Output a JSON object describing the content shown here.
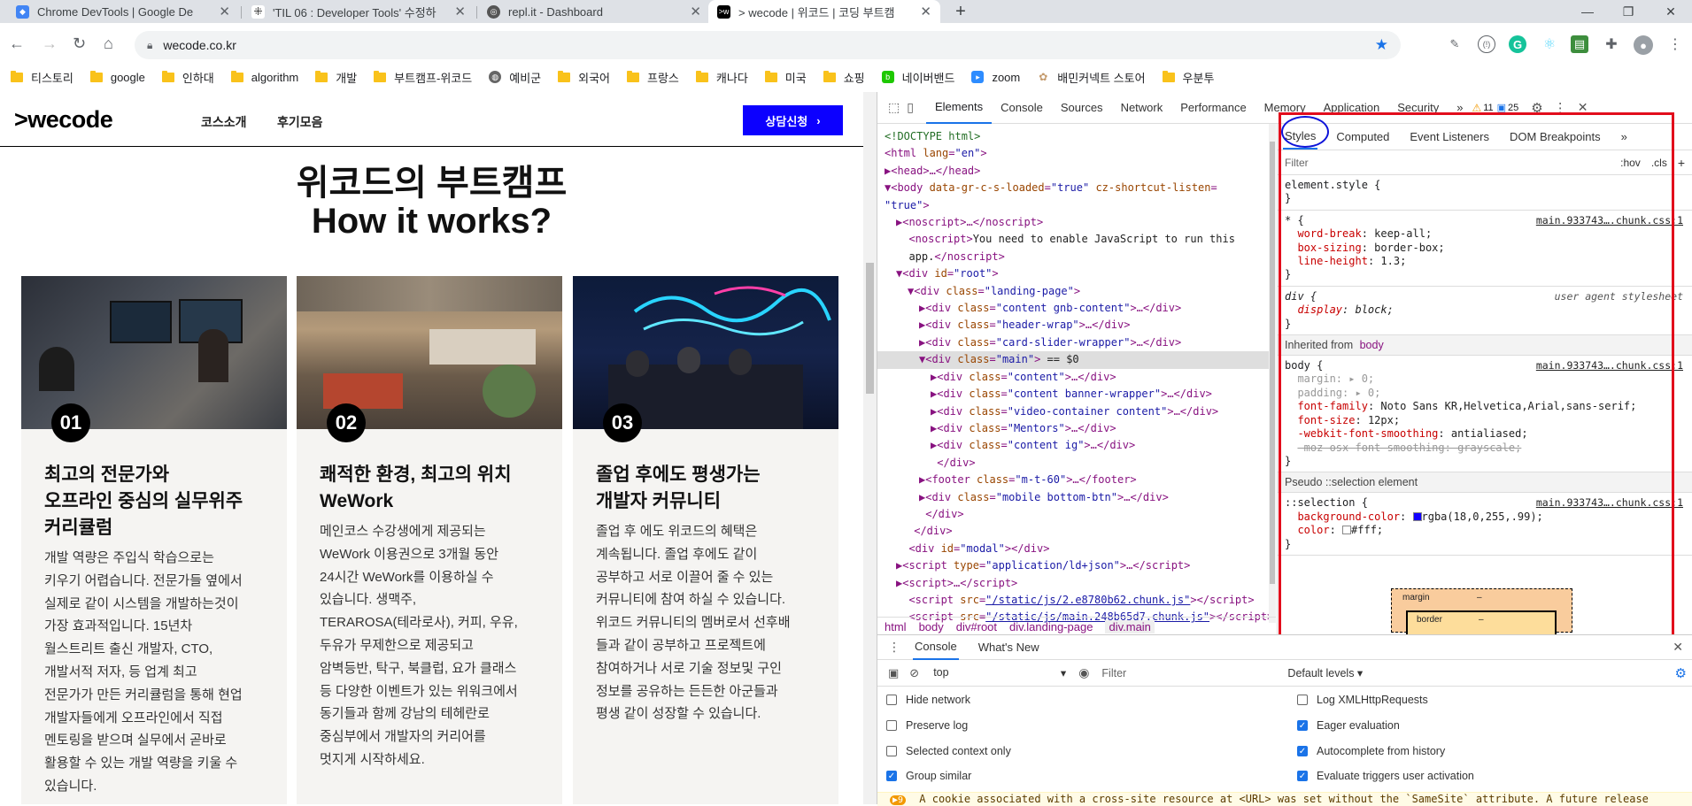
{
  "tabs": [
    {
      "title": "Chrome DevTools | Google De",
      "favicon_color": "#4285f4",
      "active": false
    },
    {
      "title": "'TIL 06 : Developer Tools' 수정하",
      "favicon_color": "#333333",
      "active": false
    },
    {
      "title": "repl.it - Dashboard",
      "favicon_color": "#555555",
      "active": false
    },
    {
      "title": "> wecode | 위코드 | 코딩 부트캠",
      "favicon_color": "#000000",
      "active": true
    }
  ],
  "new_tab_label": "+",
  "address": {
    "url": "wecode.co.kr"
  },
  "bookmarks": [
    {
      "label": "티스토리",
      "kind": "folder"
    },
    {
      "label": "google",
      "kind": "folder"
    },
    {
      "label": "인하대",
      "kind": "folder"
    },
    {
      "label": "algorithm",
      "kind": "folder"
    },
    {
      "label": "개발",
      "kind": "folder"
    },
    {
      "label": "부트캠프-위코드",
      "kind": "folder"
    },
    {
      "label": "예비군",
      "kind": "globe"
    },
    {
      "label": "외국어",
      "kind": "folder"
    },
    {
      "label": "프랑스",
      "kind": "folder"
    },
    {
      "label": "캐나다",
      "kind": "folder"
    },
    {
      "label": "미국",
      "kind": "folder"
    },
    {
      "label": "쇼핑",
      "kind": "folder"
    },
    {
      "label": "네이버밴드",
      "kind": "band"
    },
    {
      "label": "zoom",
      "kind": "zoom"
    },
    {
      "label": "배민커넥트 스토어",
      "kind": "baemin"
    },
    {
      "label": "우분투",
      "kind": "folder"
    }
  ],
  "site": {
    "logo": ">wecode",
    "nav": [
      "코스소개",
      "후기모음"
    ],
    "cta": "상담신청",
    "heading_line1": "위코드의 부트캠프",
    "heading_line2": "How it works?",
    "cards": [
      {
        "num": "01",
        "title": [
          "최고의 전문가와",
          "오프라인 중심의 실무위주",
          "커리큘럼"
        ],
        "body": [
          "개발 역량은 주입식 학습으로는",
          "키우기 어렵습니다. 전문가들 옆에서",
          "실제로 같이 시스템을 개발하는것이",
          "가장 효과적입니다. 15년차",
          "월스트리트 출신 개발자, CTO,",
          "개발서적 저자, 등 업계 최고",
          "전문가가 만든 커리큘럼을 통해 현업",
          "개발자들에게 오프라인에서 직접",
          "멘토링을 받으며 실무에서 곧바로",
          "활용할 수 있는 개발 역량을 키울 수",
          "있습니다."
        ]
      },
      {
        "num": "02",
        "title": [
          "쾌적한 환경, 최고의 위치",
          "WeWork"
        ],
        "body": [
          "메인코스 수강생에게 제공되는",
          "WeWork 이용권으로 3개월 동안",
          "24시간 WeWork를 이용하실 수",
          "있습니다. 생맥주,",
          "TERAROSA(테라로사), 커피, 우유,",
          "두유가 무제한으로 제공되고",
          "암벽등반, 탁구, 북클럽, 요가 클래스",
          "등 다양한 이벤트가 있는 위워크에서",
          "동기들과 함께 강남의 테헤란로",
          "중심부에서 개발자의 커리어를",
          "멋지게 시작하세요."
        ]
      },
      {
        "num": "03",
        "title": [
          "졸업 후에도 평생가는",
          "개발자 커뮤니티"
        ],
        "body": [
          "졸업 후 에도 위코드의 혜택은",
          "계속됩니다. 졸업 후에도 같이",
          "공부하고 서로 이끌어 줄 수 있는",
          "커뮤니티에 참여 하실 수 있습니다.",
          "위코드 커뮤니티의 멤버로서 선후배",
          "들과 같이 공부하고 프로젝트에",
          "참여하거나 서로 기술 정보및 구인",
          "정보를 공유하는 든든한 아군들과",
          "평생 같이 성장할 수 있습니다."
        ]
      }
    ]
  },
  "devtools": {
    "tabs": [
      "Elements",
      "Console",
      "Sources",
      "Network",
      "Performance",
      "Memory",
      "Application",
      "Security",
      "»"
    ],
    "warn_count": "11",
    "info_count": "25",
    "dom": [
      {
        "indent": 0,
        "html": "<span class='cm'>&lt;!DOCTYPE html&gt;</span>"
      },
      {
        "indent": 0,
        "html": "&lt;html <span class='an'>lang</span>=<span class='av'>\"en\"</span>&gt;"
      },
      {
        "indent": 0,
        "html": "▶&lt;head&gt;…&lt;/head&gt;"
      },
      {
        "indent": 0,
        "html": "▼&lt;body <span class='an'>data-gr-c-s-loaded</span>=<span class='av'>\"true\"</span> <span class='an'>cz-shortcut-listen</span>="
      },
      {
        "indent": 0,
        "html": "<span class='av'>\"true\"</span>&gt;"
      },
      {
        "indent": 1,
        "html": "▶&lt;noscript&gt;…&lt;/noscript&gt;"
      },
      {
        "indent": 1,
        "html": "&nbsp;&nbsp;&lt;noscript&gt;<span class='tx'>You need to enable JavaScript to run this</span>"
      },
      {
        "indent": 1,
        "html": "&nbsp;&nbsp;<span class='tx'>app.</span>&lt;/noscript&gt;"
      },
      {
        "indent": 1,
        "html": "▼&lt;div <span class='an'>id</span>=<span class='av'>\"root\"</span>&gt;"
      },
      {
        "indent": 2,
        "html": "▼&lt;div <span class='an'>class</span>=<span class='av'>\"landing-page\"</span>&gt;"
      },
      {
        "indent": 3,
        "html": "▶&lt;div <span class='an'>class</span>=<span class='av'>\"content gnb-content\"</span>&gt;…&lt;/div&gt;"
      },
      {
        "indent": 3,
        "html": "▶&lt;div <span class='an'>class</span>=<span class='av'>\"header-wrap\"</span>&gt;…&lt;/div&gt;"
      },
      {
        "indent": 3,
        "html": "▶&lt;div <span class='an'>class</span>=<span class='av'>\"card-slider-wrapper\"</span>&gt;…&lt;/div&gt;"
      },
      {
        "indent": 3,
        "html": "▼&lt;div <span class='an'>class</span>=<span class='av'>\"main\"</span>&gt; <span class='tx'>== $0</span>",
        "selected": true
      },
      {
        "indent": 4,
        "html": "▶&lt;div <span class='an'>class</span>=<span class='av'>\"content\"</span>&gt;…&lt;/div&gt;"
      },
      {
        "indent": 4,
        "html": "▶&lt;div <span class='an'>class</span>=<span class='av'>\"content banner-wrapper\"</span>&gt;…&lt;/div&gt;"
      },
      {
        "indent": 4,
        "html": "▶&lt;div <span class='an'>class</span>=<span class='av'>\"video-container content\"</span>&gt;…&lt;/div&gt;"
      },
      {
        "indent": 4,
        "html": "▶&lt;div <span class='an'>class</span>=<span class='av'>\"Mentors\"</span>&gt;…&lt;/div&gt;"
      },
      {
        "indent": 4,
        "html": "▶&lt;div <span class='an'>class</span>=<span class='av'>\"content ig\"</span>&gt;…&lt;/div&gt;"
      },
      {
        "indent": 4,
        "html": "&nbsp;&lt;/div&gt;"
      },
      {
        "indent": 3,
        "html": "▶&lt;footer <span class='an'>class</span>=<span class='av'>\"m-t-60\"</span>&gt;…&lt;/footer&gt;"
      },
      {
        "indent": 3,
        "html": "▶&lt;div <span class='an'>class</span>=<span class='av'>\"mobile bottom-btn\"</span>&gt;…&lt;/div&gt;"
      },
      {
        "indent": 3,
        "html": "&nbsp;&lt;/div&gt;"
      },
      {
        "indent": 2,
        "html": "&nbsp;&lt;/div&gt;"
      },
      {
        "indent": 1,
        "html": "&nbsp;&nbsp;&lt;div <span class='an'>id</span>=<span class='av'>\"modal\"</span>&gt;&lt;/div&gt;"
      },
      {
        "indent": 1,
        "html": "▶&lt;script <span class='an'>type</span>=<span class='av'>\"application/ld+json\"</span>&gt;…&lt;/script&gt;"
      },
      {
        "indent": 1,
        "html": "▶&lt;script&gt;…&lt;/script&gt;"
      },
      {
        "indent": 1,
        "html": "&nbsp;&nbsp;&lt;script <span class='an'>src</span>=<span class='lk'>\"/static/js/2.e8780b62.chunk.js\"</span>&gt;&lt;/script&gt;"
      },
      {
        "indent": 1,
        "html": "&nbsp;&nbsp;&lt;script <span class='an'>src</span>=<span class='lk'>\"/static/js/main.248b65d7.chunk.js\"</span>&gt;&lt;/script&gt;"
      }
    ],
    "breadcrumb": [
      "html",
      "body",
      "div#root",
      "div.landing-page",
      "div.main"
    ],
    "styles_tabs": [
      "Styles",
      "Computed",
      "Event Listeners",
      "DOM Breakpoints",
      "»"
    ],
    "filter_placeholder": "Filter",
    "hov": ":hov",
    "cls": ".cls",
    "element_style": "element.style {",
    "source_link": "main.933743….chunk.css:1",
    "ua_source": "user agent stylesheet",
    "inherited_label": "Inherited from",
    "inherited_from": "body",
    "pseudo_label": "Pseudo ::selection element",
    "selection_color": "#1200ff",
    "box_margin": "margin",
    "box_border": "border",
    "box_dash": "–"
  },
  "drawer": {
    "tabs": [
      "Console",
      "What's New"
    ],
    "context": "top",
    "filter_placeholder": "Filter",
    "levels": "Default levels ▾",
    "options_left": [
      {
        "label": "Hide network",
        "checked": false
      },
      {
        "label": "Preserve log",
        "checked": false
      },
      {
        "label": "Selected context only",
        "checked": false
      },
      {
        "label": "Group similar",
        "checked": true
      }
    ],
    "options_right": [
      {
        "label": "Log XMLHttpRequests",
        "checked": false
      },
      {
        "label": "Eager evaluation",
        "checked": true
      },
      {
        "label": "Autocomplete from history",
        "checked": true
      },
      {
        "label": "Evaluate triggers user activation",
        "checked": true
      }
    ],
    "warning_count": "▶9",
    "warning_text": "A cookie associated with a cross-site resource at <URL> was set without the `SameSite` attribute. A future release"
  }
}
